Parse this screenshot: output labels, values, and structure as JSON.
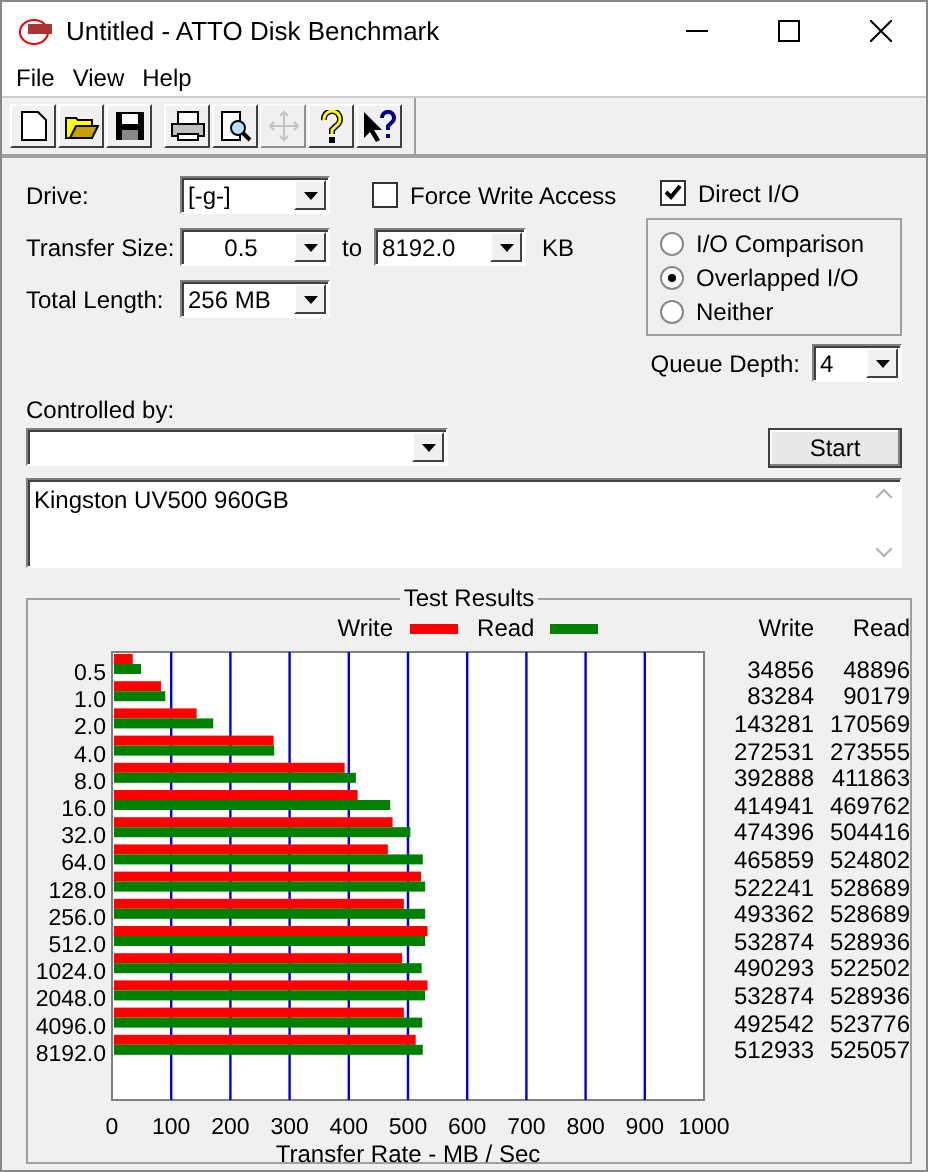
{
  "window": {
    "title": "Untitled - ATTO Disk Benchmark"
  },
  "menu": [
    {
      "label": "File"
    },
    {
      "label": "View"
    },
    {
      "label": "Help"
    }
  ],
  "toolbar": [
    {
      "kind": "new",
      "disabled": false
    },
    {
      "kind": "open",
      "disabled": false
    },
    {
      "kind": "save",
      "disabled": false
    },
    {
      "kind": "print",
      "disabled": false
    },
    {
      "kind": "preview",
      "disabled": false
    },
    {
      "kind": "move",
      "disabled": true
    },
    {
      "kind": "help",
      "disabled": false
    },
    {
      "kind": "context_help",
      "disabled": false
    }
  ],
  "form": {
    "drive": {
      "label": "Drive:",
      "value": "[-g-]"
    },
    "force_write_access": {
      "label": "Force Write Access",
      "checked": false
    },
    "transfer_size": {
      "label": "Transfer Size:",
      "from": "0.5",
      "to_label": "to",
      "to": "8192.0",
      "unit": "KB"
    },
    "total_length": {
      "label": "Total Length:",
      "value": "256 MB"
    },
    "direct_io": {
      "label": "Direct I/O",
      "checked": true
    },
    "io_mode": [
      {
        "label": "I/O Comparison",
        "selected": false
      },
      {
        "label": "Overlapped I/O",
        "selected": true
      },
      {
        "label": "Neither",
        "selected": false
      }
    ],
    "queue_depth": {
      "label": "Queue Depth:",
      "value": "4"
    },
    "controlled_by": {
      "label": "Controlled by:"
    },
    "start_button": {
      "label": "Start"
    },
    "description": "Kingston UV500 960GB"
  },
  "results": {
    "title": "Test Results",
    "table_columns": [
      "Write",
      "Read"
    ],
    "rows": [
      {
        "write": "34856",
        "read": "48896"
      },
      {
        "write": "83284",
        "read": "90179"
      },
      {
        "write": "143281",
        "read": "170569"
      },
      {
        "write": "272531",
        "read": "273555"
      },
      {
        "write": "392888",
        "read": "411863"
      },
      {
        "write": "414941",
        "read": "469762"
      },
      {
        "write": "474396",
        "read": "504416"
      },
      {
        "write": "465859",
        "read": "524802"
      },
      {
        "write": "522241",
        "read": "528689"
      },
      {
        "write": "493362",
        "read": "528689"
      },
      {
        "write": "532874",
        "read": "528936"
      },
      {
        "write": "490293",
        "read": "522502"
      },
      {
        "write": "532874",
        "read": "528936"
      },
      {
        "write": "492542",
        "read": "523776"
      },
      {
        "write": "512933",
        "read": "525057"
      }
    ],
    "chart_data": {
      "type": "bar",
      "orientation": "horizontal",
      "xlabel": "Transfer Rate - MB / Sec",
      "categories": [
        "0.5",
        "1.0",
        "2.0",
        "4.0",
        "8.0",
        "16.0",
        "32.0",
        "64.0",
        "128.0",
        "256.0",
        "512.0",
        "1024.0",
        "2048.0",
        "4096.0",
        "8192.0"
      ],
      "series": [
        {
          "name": "Write",
          "color": "#ff0000",
          "values": [
            35,
            83,
            143,
            273,
            393,
            415,
            474,
            466,
            522,
            493,
            533,
            490,
            533,
            493,
            513
          ]
        },
        {
          "name": "Read",
          "color": "#008000",
          "values": [
            49,
            90,
            171,
            274,
            412,
            470,
            504,
            525,
            529,
            529,
            529,
            523,
            529,
            524,
            525
          ]
        }
      ],
      "grid": true,
      "xlim": [
        0,
        1000
      ],
      "xticks": [
        0,
        100,
        200,
        300,
        400,
        500,
        600,
        700,
        800,
        900,
        1000
      ]
    }
  }
}
